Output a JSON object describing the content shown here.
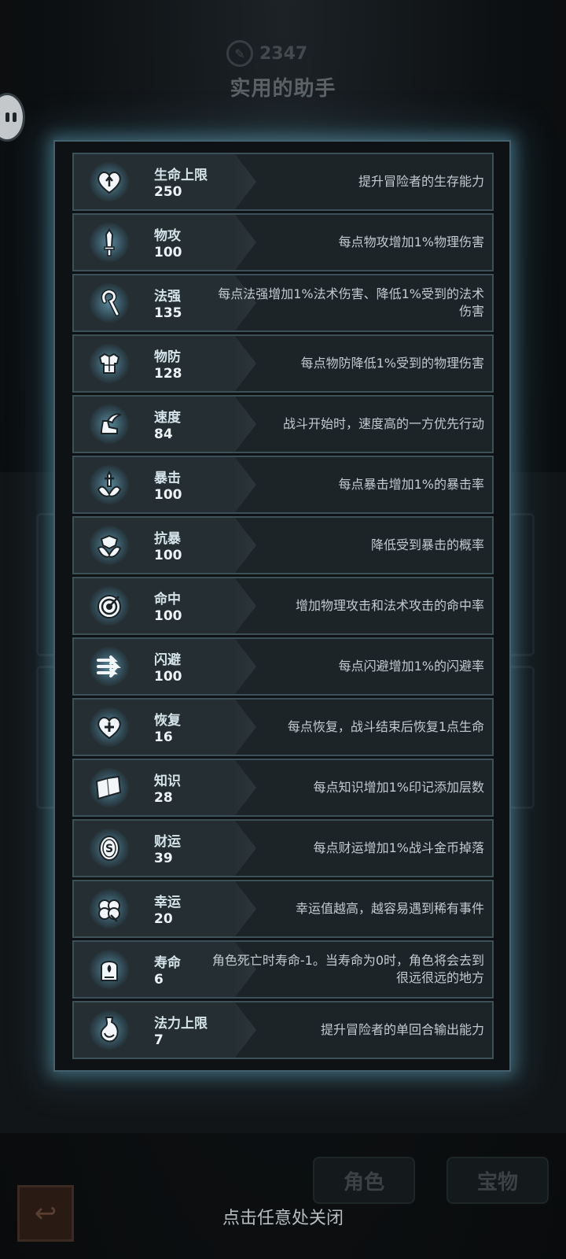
{
  "header": {
    "currency_amount": "2347",
    "title": "实用的助手"
  },
  "stats": [
    {
      "name": "生命上限",
      "value": "250",
      "desc": "提升冒险者的生存能力",
      "icon": "heart-arrow-icon"
    },
    {
      "name": "物攻",
      "value": "100",
      "desc": "每点物攻增加1%物理伤害",
      "icon": "sword-icon"
    },
    {
      "name": "法强",
      "value": "135",
      "desc": "每点法强增加1%法术伤害、降低1%受到的法术伤害",
      "icon": "staff-icon"
    },
    {
      "name": "物防",
      "value": "128",
      "desc": "每点物防降低1%受到的物理伤害",
      "icon": "armor-icon"
    },
    {
      "name": "速度",
      "value": "84",
      "desc": "战斗开始时，速度高的一方优先行动",
      "icon": "winged-boot-icon"
    },
    {
      "name": "暴击",
      "value": "100",
      "desc": "每点暴击增加1%的暴击率",
      "icon": "crit-blade-icon"
    },
    {
      "name": "抗暴",
      "value": "100",
      "desc": "降低受到暴击的概率",
      "icon": "crit-shield-icon"
    },
    {
      "name": "命中",
      "value": "100",
      "desc": "增加物理攻击和法术攻击的命中率",
      "icon": "target-icon"
    },
    {
      "name": "闪避",
      "value": "100",
      "desc": "每点闪避增加1%的闪避率",
      "icon": "dodge-arrows-icon"
    },
    {
      "name": "恢复",
      "value": "16",
      "desc": "每点恢复，战斗结束后恢复1点生命",
      "icon": "heart-plus-icon"
    },
    {
      "name": "知识",
      "value": "28",
      "desc": "每点知识增加1%印记添加层数",
      "icon": "book-icon"
    },
    {
      "name": "财运",
      "value": "39",
      "desc": "每点财运增加1%战斗金币掉落",
      "icon": "coin-icon"
    },
    {
      "name": "幸运",
      "value": "20",
      "desc": "幸运值越高，越容易遇到稀有事件",
      "icon": "clover-icon"
    },
    {
      "name": "寿命",
      "value": "6",
      "desc": "角色死亡时寿命-1。当寿命为0时，角色将会去到很远很远的地方",
      "icon": "tombstone-icon"
    },
    {
      "name": "法力上限",
      "value": "7",
      "desc": "提升冒险者的单回合输出能力",
      "icon": "mana-flask-icon"
    }
  ],
  "bottom_nav": {
    "role_tab": "角色",
    "treasure_tab": "宝物",
    "close_hint": "点击任意处关闭"
  }
}
